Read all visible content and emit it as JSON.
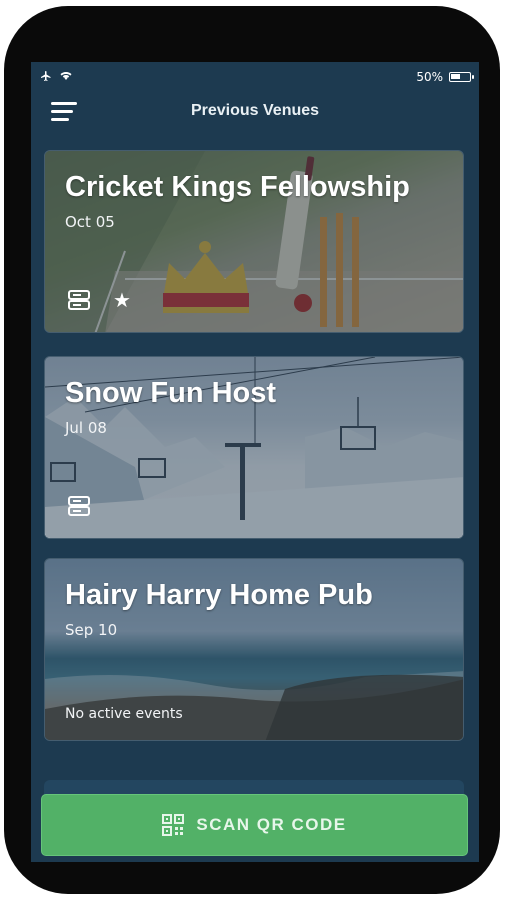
{
  "status_bar": {
    "battery_percent": "50%"
  },
  "header": {
    "title": "Previous Venues"
  },
  "venues": [
    {
      "name": "Cricket Kings Fellowship",
      "date": "Oct 05",
      "subtitle": ""
    },
    {
      "name": "Snow Fun Host",
      "date": "Jul 08",
      "subtitle": ""
    },
    {
      "name": "Hairy Harry Home Pub",
      "date": "Sep 10",
      "subtitle": "No active events"
    }
  ],
  "scan_button": {
    "label": "SCAN QR CODE"
  },
  "colors": {
    "background": "#1d3a50",
    "accent_green": "#52b167",
    "text": "#ffffff"
  },
  "icons": {
    "menu": "hamburger-icon",
    "airplane": "airplane-icon",
    "wifi": "wifi-icon",
    "battery": "battery-icon",
    "events": "database-icon",
    "favorite": "star-icon",
    "qr": "qr-code-icon"
  }
}
